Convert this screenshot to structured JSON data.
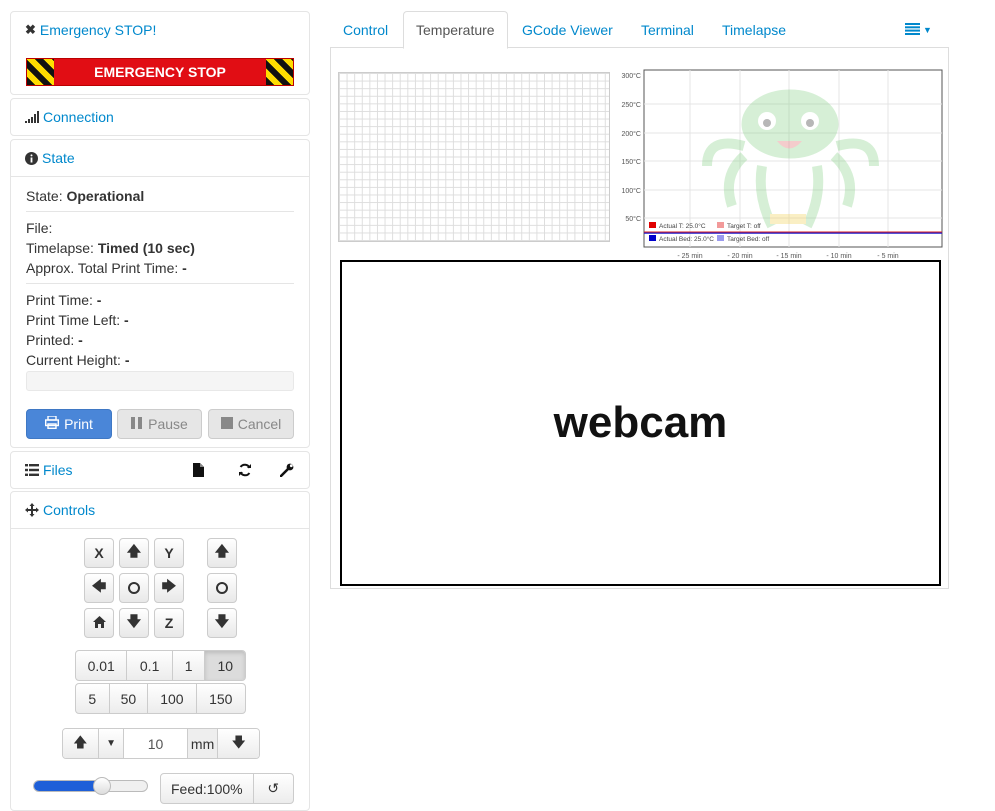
{
  "estop_panel": {
    "title": "Emergency STOP!",
    "button": "EMERGENCY STOP"
  },
  "connection": {
    "title": "Connection"
  },
  "state": {
    "title": "State",
    "state_label": "State:",
    "state_value": "Operational",
    "file_label": "File:",
    "timelapse_label": "Timelapse:",
    "timelapse_value": "Timed (10 sec)",
    "total_label": "Approx. Total Print Time:",
    "total_value": "-",
    "print_time_label": "Print Time:",
    "print_time_value": "-",
    "time_left_label": "Print Time Left:",
    "time_left_value": "-",
    "printed_label": "Printed:",
    "printed_value": "-",
    "height_label": "Current Height:",
    "height_value": "-",
    "progress": 0,
    "print_btn": "Print",
    "pause_btn": "Pause",
    "cancel_btn": "Cancel"
  },
  "files": {
    "title": "Files"
  },
  "controls": {
    "title": "Controls",
    "x": "X",
    "y": "Y",
    "z": "Z",
    "distances_row1": [
      "0.01",
      "0.1",
      "1",
      "10"
    ],
    "distances_row2": [
      "5",
      "50",
      "100",
      "150"
    ],
    "selected_distance": "10",
    "extrude_amount": "10",
    "extrude_unit": "mm",
    "feed": "Feed:100%",
    "feed_slider_fraction": 0.6
  },
  "tabs": [
    "Control",
    "Temperature",
    "GCode Viewer",
    "Terminal",
    "Timelapse"
  ],
  "active_tab": "Temperature",
  "temp_graph": {
    "y_ticks": [
      "300°C",
      "250°C",
      "200°C",
      "150°C",
      "100°C",
      "50°C"
    ],
    "x_ticks": [
      "- 25 min",
      "- 20 min",
      "- 15 min",
      "- 10 min",
      "- 5 min"
    ],
    "legend": [
      "Actual T: 25.0°C",
      "Target T: off",
      "Actual Bed: 25.0°C",
      "Target Bed: off"
    ]
  },
  "webcam": {
    "label": "webcam"
  },
  "colors": {
    "link": "#0088cc",
    "estop_red": "#e10d14",
    "primary": "#4a86d8"
  }
}
